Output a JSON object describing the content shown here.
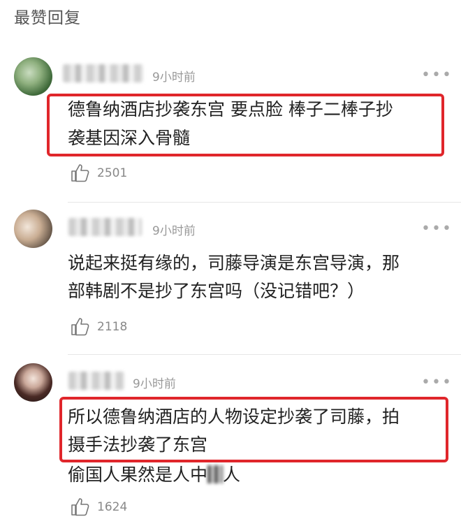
{
  "section_title": "最赞回复",
  "comments": [
    {
      "time": "9小时前",
      "line1": "德鲁纳酒店抄袭东宫 要点脸 棒子二棒子抄",
      "line2": "袭基因深入骨髓",
      "likes": "2501"
    },
    {
      "time": "9小时前",
      "line1": "说起来挺有缘的，司藤导演是东宫导演，那",
      "line2": "部韩剧不是抄了东宫吗（没记错吧？）",
      "likes": "2118"
    },
    {
      "time": "9小时前",
      "line1": "所以德鲁纳酒店的人物设定抄袭了司藤，拍",
      "line2": "摄手法抄袭了东宫",
      "line3_a": "偷国人果然是人中",
      "line3_b": "人",
      "likes": "1624"
    }
  ],
  "icons": {
    "like": "thumbs-up-icon",
    "more": "more-dots-icon"
  },
  "colors": {
    "highlight_border": "#e0262b",
    "text": "#222222",
    "meta": "#999999"
  }
}
